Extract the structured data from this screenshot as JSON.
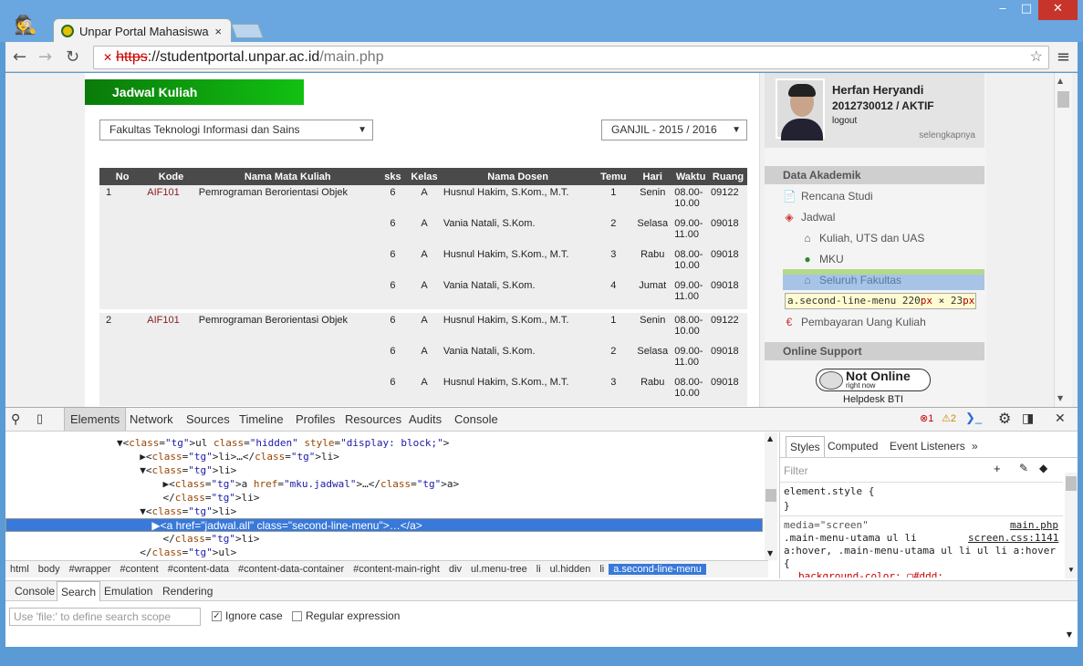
{
  "window": {
    "minimize": "‒",
    "maximize": "□",
    "close": "✕"
  },
  "tab": {
    "title": "Unpar Portal Mahasiswa",
    "close": "×"
  },
  "address": {
    "scheme": "https",
    "host": "://studentportal.unpar.ac.id",
    "path": "/main.php"
  },
  "content": {
    "heading": "Jadwal Kuliah",
    "faculty_select": "Fakultas Teknologi Informasi dan Sains",
    "term_select": "GANJIL - 2015 / 2016",
    "columns": [
      "No",
      "Kode",
      "Nama Mata Kuliah",
      "sks",
      "Kelas",
      "Nama Dosen",
      "Temu",
      "Hari",
      "Waktu",
      "Ruang"
    ],
    "rows": [
      {
        "no": "1",
        "kode": "AIF101",
        "mk": "Pemrograman Berorientasi Objek",
        "sks": "6",
        "kelas": "A",
        "dosen": "Husnul Hakim, S.Kom., M.T.",
        "temu": "1",
        "hari": "Senin",
        "waktu": "08.00-\n10.00",
        "ruang": "09122"
      },
      {
        "no": "",
        "kode": "",
        "mk": "",
        "sks": "6",
        "kelas": "A",
        "dosen": "Vania Natali, S.Kom.",
        "temu": "2",
        "hari": "Selasa",
        "waktu": "09.00-\n11.00",
        "ruang": "09018"
      },
      {
        "no": "",
        "kode": "",
        "mk": "",
        "sks": "6",
        "kelas": "A",
        "dosen": "Husnul Hakim, S.Kom., M.T.",
        "temu": "3",
        "hari": "Rabu",
        "waktu": "08.00-\n10.00",
        "ruang": "09018"
      },
      {
        "no": "",
        "kode": "",
        "mk": "",
        "sks": "6",
        "kelas": "A",
        "dosen": "Vania Natali, S.Kom.",
        "temu": "4",
        "hari": "Jumat",
        "waktu": "09.00-\n11.00",
        "ruang": "09018"
      },
      {
        "no": "2",
        "kode": "AIF101",
        "mk": "Pemrograman Berorientasi Objek",
        "sks": "6",
        "kelas": "A",
        "dosen": "Husnul Hakim, S.Kom., M.T.",
        "temu": "1",
        "hari": "Senin",
        "waktu": "08.00-\n10.00",
        "ruang": "09122"
      },
      {
        "no": "",
        "kode": "",
        "mk": "",
        "sks": "6",
        "kelas": "A",
        "dosen": "Vania Natali, S.Kom.",
        "temu": "2",
        "hari": "Selasa",
        "waktu": "09.00-\n11.00",
        "ruang": "09018"
      },
      {
        "no": "",
        "kode": "",
        "mk": "",
        "sks": "6",
        "kelas": "A",
        "dosen": "Husnul Hakim, S.Kom., M.T.",
        "temu": "3",
        "hari": "Rabu",
        "waktu": "08.00-\n10.00",
        "ruang": "09018"
      }
    ]
  },
  "sidebar": {
    "name": "Herfan Heryandi",
    "id": "2012730012 / AKTIF",
    "logout": "logout",
    "more": "selengkapnya",
    "sec_akademik": "Data Akademik",
    "rencana": "Rencana Studi",
    "jadwal": "Jadwal",
    "kuliah": "Kuliah, UTS dan UAS",
    "mku": "MKU",
    "seluruh": "Seluruh Fakultas",
    "tooltip_sel": "a.second-line-menu",
    "tooltip_w": "220",
    "tooltip_x": " × ",
    "tooltip_h": "23",
    "tooltip_px": "px",
    "pembayaran": "Pembayaran Uang Kuliah",
    "sec_support": "Online Support",
    "not_online": "Not Online",
    "right_now": "right now",
    "helpdesk": "Helpdesk BTI"
  },
  "devtools": {
    "tabs": [
      "Elements",
      "Network",
      "Sources",
      "Timeline",
      "Profiles",
      "Resources",
      "Audits",
      "Console"
    ],
    "errors": "1",
    "warnings": "2",
    "lines": [
      {
        "t": "▼<ul class=\"hidden\" style=\"display: block;\">"
      },
      {
        "t": "  ▶<li>…</li>"
      },
      {
        "t": "  ▼<li>"
      },
      {
        "t": "    ▶<a href=\"mku.jadwal\">…</a>"
      },
      {
        "t": "    </li>"
      },
      {
        "t": "  ▼<li>"
      },
      {
        "t": "    ▶<a href=\"jadwal.all\" class=\"second-line-menu\">…</a>"
      },
      {
        "t": "    </li>"
      },
      {
        "t": "  </ul>"
      }
    ],
    "crumbs": [
      "html",
      "body",
      "#wrapper",
      "#content",
      "#content-data",
      "#content-data-container",
      "#content-main-right",
      "div",
      "ul.menu-tree",
      "li",
      "ul.hidden",
      "li",
      "a.second-line-menu"
    ],
    "style_tabs": [
      "Styles",
      "Computed",
      "Event Listeners",
      "»"
    ],
    "filter": "Filter",
    "el_style": "element.style {",
    "close_brace": "}",
    "media": "media=\"screen\"",
    "src1": "main.php",
    "src2": "screen.css:1141",
    "rule1": ".main-menu-utama ul li",
    "rule2": "a:hover, .main-menu-utama ul li ul li a:hover",
    "rule3": "{",
    "rule4": "background-color: ▢#ddd;",
    "drawer_tabs": [
      "Console",
      "Search",
      "Emulation",
      "Rendering"
    ],
    "search_placeholder": "Use 'file:' to define search scope",
    "ignore_case": "Ignore case",
    "regex": "Regular expression"
  }
}
